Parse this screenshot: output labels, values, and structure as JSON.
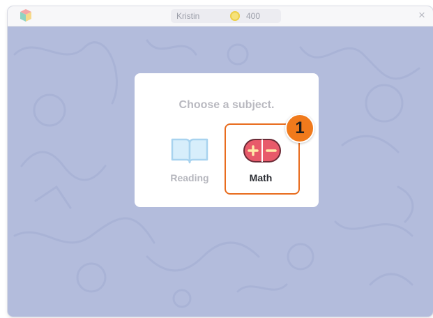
{
  "window": {
    "user_name": "Kristin",
    "coins": "400",
    "close_symbol": "×"
  },
  "dialog": {
    "title": "Choose a subject.",
    "subjects": [
      {
        "label": "Reading",
        "icon": "book-icon",
        "selected": false
      },
      {
        "label": "Math",
        "icon": "plus-minus-icon",
        "selected": true
      }
    ]
  },
  "annotation": {
    "step": "1"
  },
  "colors": {
    "background": "#b3bcdc",
    "accent": "#e86c1e",
    "math_icon": "#e85a6a",
    "reading_icon": "#a8d3ef"
  }
}
